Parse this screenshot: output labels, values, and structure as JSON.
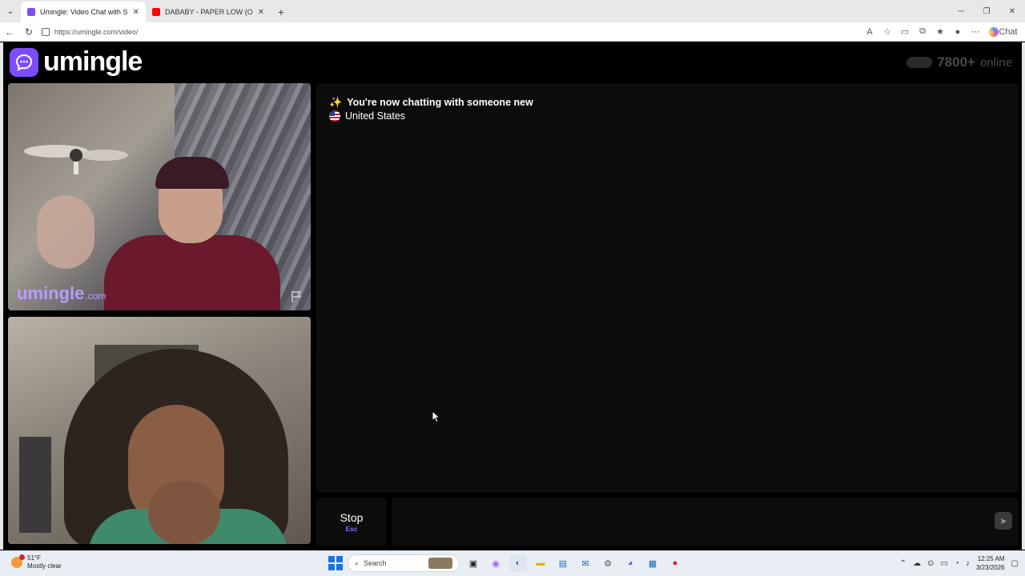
{
  "browser": {
    "tabs": [
      {
        "title": "Umingle: Video Chat with Stra",
        "active": true
      },
      {
        "title": "DABABY - PAPER LOW (OFFICIAL M",
        "active": false
      }
    ],
    "url": "https://umingle.com/video/",
    "chat_label": "Chat"
  },
  "site": {
    "logo_text": "umingle",
    "online_count": "7800+",
    "online_label": "online"
  },
  "video": {
    "watermark_main": "umingle",
    "watermark_domain": ".com"
  },
  "chat": {
    "status_message": "You're now chatting with someone new",
    "country": "United States"
  },
  "controls": {
    "stop_label": "Stop",
    "stop_shortcut": "Esc",
    "message_placeholder": ""
  },
  "taskbar": {
    "weather_temp": "51°F",
    "weather_desc": "Mostly clear",
    "search_label": "Search",
    "time": "12:25 AM",
    "date": "3/23/2026"
  },
  "colors": {
    "brand": "#7c4dff",
    "background": "#000000",
    "panel": "#0c0c0c"
  }
}
